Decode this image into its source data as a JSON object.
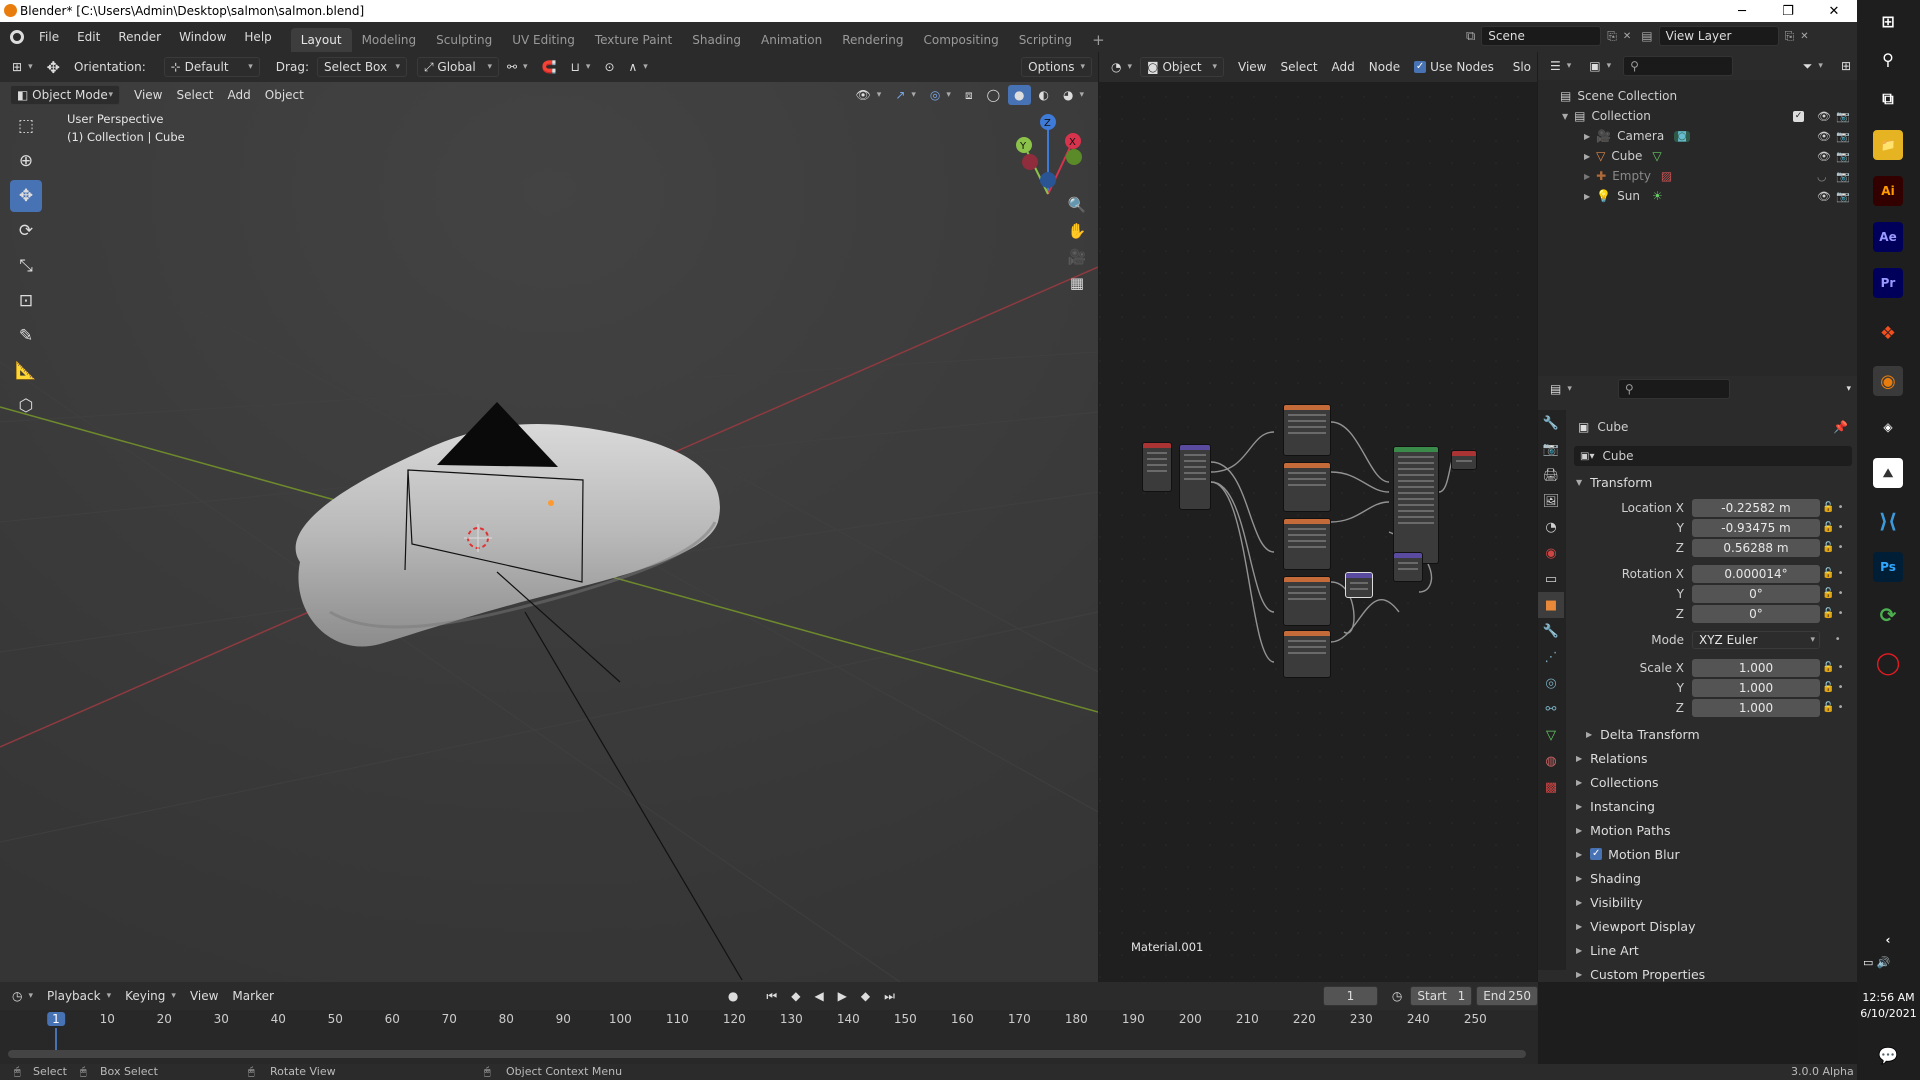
{
  "window": {
    "title": "Blender* [C:\\Users\\Admin\\Desktop\\salmon\\salmon.blend]",
    "minimize": "─",
    "maximize": "❐",
    "close": "✕"
  },
  "menubar": {
    "items": [
      "File",
      "Edit",
      "Render",
      "Window",
      "Help"
    ]
  },
  "workspaces": {
    "active": "Layout",
    "tabs": [
      "Layout",
      "Modeling",
      "Sculpting",
      "UV Editing",
      "Texture Paint",
      "Shading",
      "Animation",
      "Rendering",
      "Compositing",
      "Scripting"
    ],
    "add": "+"
  },
  "scene": {
    "label": "Scene",
    "view_layer": "View Layer"
  },
  "viewport": {
    "orientation_label": "Orientation:",
    "orientation_value": "Default",
    "drag_label": "Drag:",
    "drag_value": "Select Box",
    "transform_space": "Global",
    "options": "Options",
    "mode": "Object Mode",
    "menus": [
      "View",
      "Select",
      "Add",
      "Object"
    ],
    "overlay_line1": "User Perspective",
    "overlay_line2": "(1) Collection | Cube",
    "gizmo": {
      "x": "X",
      "y": "Y",
      "z": "Z"
    }
  },
  "node_editor": {
    "object_label": "Object",
    "menus": [
      "View",
      "Select",
      "Add",
      "Node"
    ],
    "use_nodes_label": "Use Nodes",
    "use_nodes": true,
    "slot_label": "Slo",
    "material": "Material.001"
  },
  "outliner": {
    "root": "Scene Collection",
    "collection": "Collection",
    "items": [
      {
        "name": "Camera",
        "icon": "camera-icon",
        "color": "#e28a4a"
      },
      {
        "name": "Cube",
        "icon": "mesh-icon",
        "color": "#e28a4a"
      },
      {
        "name": "Empty",
        "icon": "empty-icon",
        "color": "#b06a3a"
      },
      {
        "name": "Sun",
        "icon": "sun-icon",
        "color": "#e28a4a"
      }
    ]
  },
  "properties": {
    "object_name": "Cube",
    "object_field": "Cube",
    "transform_title": "Transform",
    "location": {
      "label_x": "Location X",
      "label_y": "Y",
      "label_z": "Z",
      "x": "-0.22582 m",
      "y": "-0.93475 m",
      "z": "0.56288 m"
    },
    "rotation": {
      "label_x": "Rotation X",
      "label_y": "Y",
      "label_z": "Z",
      "x": "0.000014°",
      "y": "0°",
      "z": "0°"
    },
    "mode_label": "Mode",
    "mode_value": "XYZ Euler",
    "scale": {
      "label_x": "Scale X",
      "label_y": "Y",
      "label_z": "Z",
      "x": "1.000",
      "y": "1.000",
      "z": "1.000"
    },
    "delta_transform": "Delta Transform",
    "sections": [
      "Relations",
      "Collections",
      "Instancing",
      "Motion Paths",
      "Motion Blur",
      "Shading",
      "Visibility",
      "Viewport Display",
      "Line Art",
      "Custom Properties"
    ],
    "motion_blur_checked": true
  },
  "timeline": {
    "menus": [
      "Playback",
      "Keying",
      "View",
      "Marker"
    ],
    "current_frame": "1",
    "start_label": "Start",
    "start": "1",
    "end_label": "End",
    "end": "250",
    "ticks": [
      "1",
      "10",
      "20",
      "30",
      "40",
      "50",
      "60",
      "70",
      "80",
      "90",
      "100",
      "110",
      "120",
      "130",
      "140",
      "150",
      "160",
      "170",
      "180",
      "190",
      "200",
      "210",
      "220",
      "230",
      "240",
      "250"
    ]
  },
  "statusbar": {
    "select": "Select",
    "box_select": "Box Select",
    "rotate": "Rotate View",
    "context_menu": "Object Context Menu",
    "version": "3.0.0 Alpha"
  },
  "taskbar": {
    "time": "12:56 AM",
    "date": "6/10/2021"
  }
}
